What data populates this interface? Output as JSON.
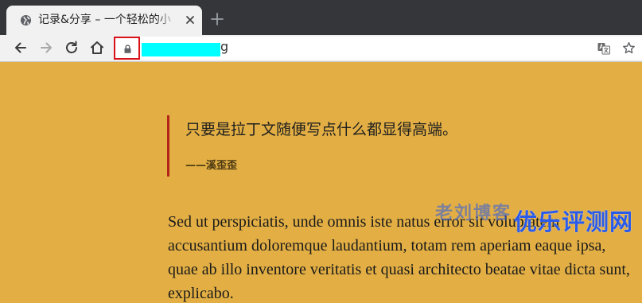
{
  "tab": {
    "title": "记录&分享 – 一个轻松的小",
    "favicon": "globe-icon",
    "close": "close-icon"
  },
  "new_tab": "plus-icon",
  "toolbar": {
    "back": "arrow-left-icon",
    "forward": "arrow-right-icon",
    "reload": "reload-icon",
    "home": "home-icon"
  },
  "omnibox": {
    "lock": "lock-icon",
    "url_tail": "g",
    "translate": "translate-icon",
    "bookmark": "star-icon"
  },
  "content": {
    "quote": "只要是拉丁文随便写点什么都显得高端。",
    "quote_author": "——溪歪歪",
    "paragraph": "Sed ut perspiciatis, unde omnis iste natus error sit voluptatem accusantium doloremque laudantium, totam rem aperiam eaque ipsa, quae ab illo inventore veritatis et quasi architecto beatae vitae dicta sunt, explicabo."
  },
  "watermarks": {
    "left": "老刘博客",
    "right": "优乐评测网"
  },
  "colors": {
    "page_background": "#e3af44",
    "quote_bar": "#b3241b",
    "url_redaction": "#00ffff",
    "highlight_box": "#d9121a",
    "watermark_blue": "#2a5be8"
  }
}
